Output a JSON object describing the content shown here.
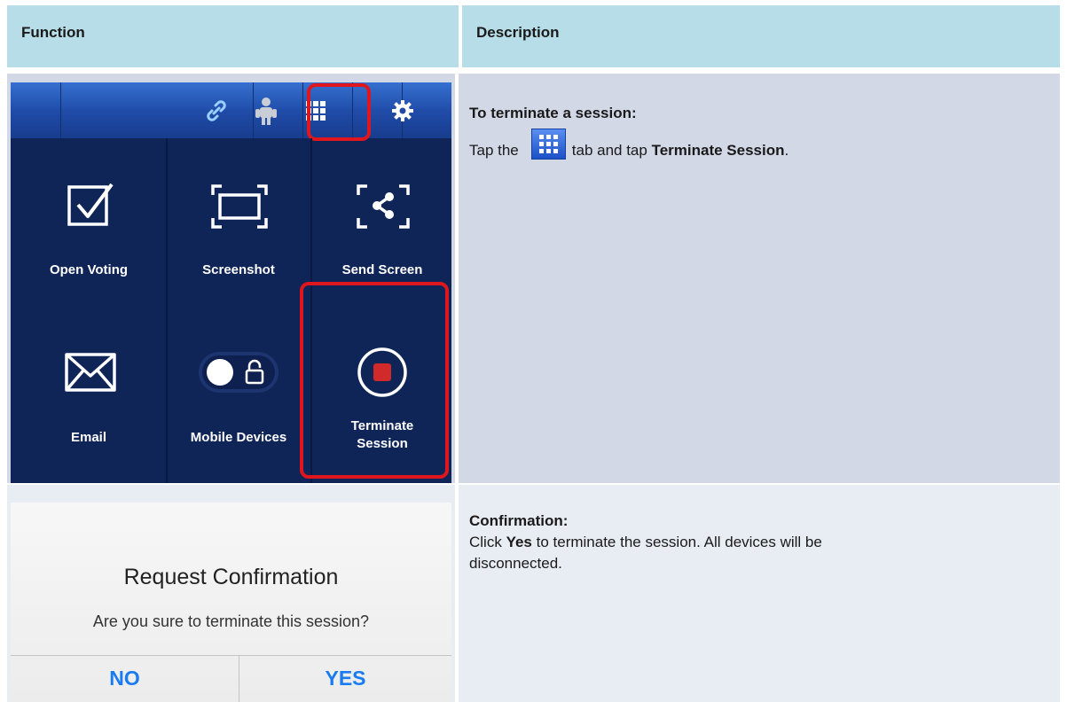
{
  "table": {
    "headers": [
      "Function",
      "Description"
    ]
  },
  "app": {
    "tiles": [
      {
        "label": "Open Voting",
        "icon": "checkbox-icon"
      },
      {
        "label": "Screenshot",
        "icon": "screenshot-frame-icon"
      },
      {
        "label": "Send Screen",
        "icon": "share-screen-icon"
      },
      {
        "label": "Email",
        "icon": "envelope-icon"
      },
      {
        "label": "Mobile Devices",
        "icon": "toggle-lock-icon"
      },
      {
        "label_line1": "Terminate",
        "label_line2": "Session",
        "icon": "stop-circle-icon"
      }
    ],
    "tabs": [
      "link-icon",
      "people-icon",
      "grid-icon",
      "gear-icon"
    ],
    "colors": {
      "panel": "#0f2558",
      "tabbar": "#1f4aa6",
      "highlight": "#e0161e"
    }
  },
  "row1": {
    "heading": "To terminate a session:",
    "text_before": "Tap the",
    "text_middle": "tab and tap",
    "bold_action": "Terminate Session",
    "text_end": "."
  },
  "dialog": {
    "title": "Request Confirmation",
    "message": "Are you sure to terminate this session?",
    "no_label": "NO",
    "yes_label": "YES"
  },
  "row2": {
    "heading": "Confirmation:",
    "text_before": "Click",
    "bold_word": "Yes",
    "text_after": "to terminate the session. All devices will be",
    "line2": "disconnected."
  }
}
